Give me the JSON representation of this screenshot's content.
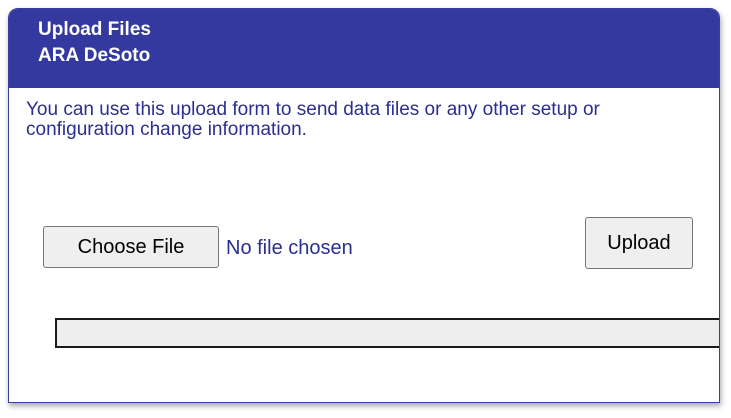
{
  "header": {
    "title": "Upload Files",
    "subtitle": "ARA DeSoto"
  },
  "description": "You can use this upload form to send data files or any other setup or configuration change information.",
  "file_input": {
    "button_label": "Choose File",
    "status_text": "No file chosen"
  },
  "upload_button": {
    "label": "Upload"
  },
  "progress": {
    "value": 0
  },
  "colors": {
    "header_bg": "#34399f",
    "text": "#2b2f8f"
  }
}
